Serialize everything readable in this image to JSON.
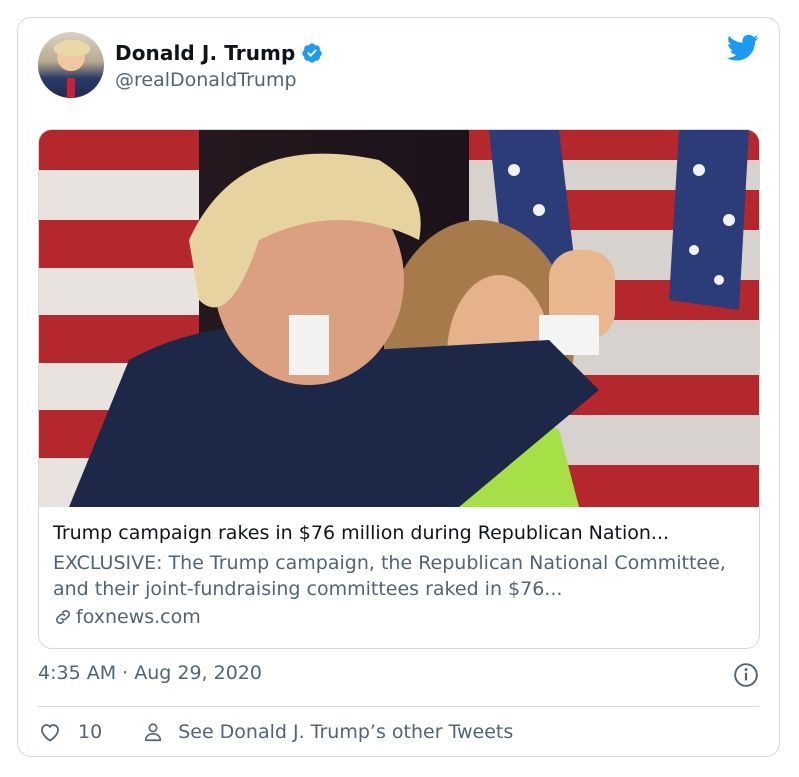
{
  "author": {
    "display_name": "Donald J. Trump",
    "handle": "@realDonaldTrump",
    "verified": true
  },
  "card": {
    "title": "Trump campaign rakes in $76 million during Republican Nation...",
    "description": "EXCLUSIVE: The Trump campaign, the Republican National Committee, and their joint-fundraising committees raked in $76...",
    "domain": "foxnews.com"
  },
  "meta": {
    "timestamp": "4:35 AM · Aug 29, 2020"
  },
  "actions": {
    "like_count": "10",
    "other_tweets_label": "See Donald J. Trump’s other Tweets"
  },
  "colors": {
    "twitter_blue": "#1d9bf0",
    "secondary_text": "#536471",
    "border": "#cfd9de"
  },
  "icons": [
    "twitter-bird-icon",
    "verified-badge-icon",
    "link-icon",
    "info-icon",
    "heart-icon",
    "person-icon"
  ]
}
